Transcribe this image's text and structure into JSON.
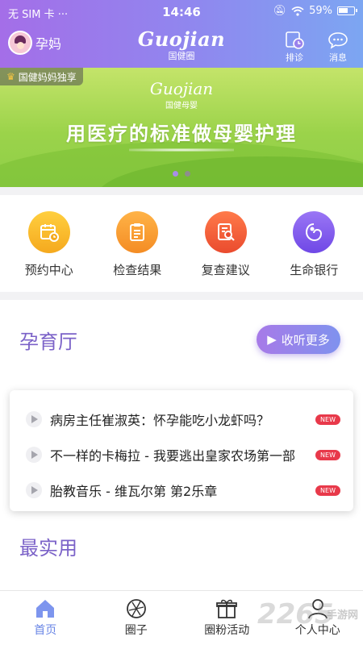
{
  "status": {
    "carrier": "无 SIM 卡 ···",
    "time": "14:46",
    "battery": "59%"
  },
  "header": {
    "mom_label": "孕妈",
    "logo_script": "Guojian",
    "logo_sub": "国健圈",
    "icons": [
      {
        "label": "排诊",
        "icon": "clock-calendar-icon"
      },
      {
        "label": "消息",
        "icon": "chat-bubble-icon"
      }
    ]
  },
  "banner": {
    "tag": "国健妈妈独享",
    "logo_script": "Guojian",
    "logo_sub": "国健母婴",
    "headline": "用医疗的标准做母婴护理",
    "slides": 2,
    "active_slide": 1
  },
  "quick": [
    {
      "label": "预约中心",
      "icon": "calendar-clock-icon",
      "color": "#f5b324"
    },
    {
      "label": "检查结果",
      "icon": "clipboard-icon",
      "color": "#f59a2b"
    },
    {
      "label": "复查建议",
      "icon": "search-report-icon",
      "color": "#f2603a"
    },
    {
      "label": "生命银行",
      "icon": "baby-icon",
      "color": "#8a5cf0"
    }
  ],
  "section1": {
    "title": "孕育厅",
    "listen_more": "收听更多"
  },
  "audio_list": [
    {
      "title": "病房主任崔淑英：怀孕能吃小龙虾吗？",
      "badge": "NEW"
    },
    {
      "title": "不一样的卡梅拉 - 我要逃出皇家农场第一部",
      "badge": "NEW"
    },
    {
      "title": "胎教音乐 - 维瓦尔第 第2乐章",
      "badge": "NEW"
    }
  ],
  "section2": {
    "title": "最实用"
  },
  "bottom_nav": [
    {
      "label": "首页",
      "icon": "home-icon",
      "active": true
    },
    {
      "label": "圈子",
      "icon": "aperture-icon",
      "active": false
    },
    {
      "label": "圈粉活动",
      "icon": "gift-icon",
      "active": false
    },
    {
      "label": "个人中心",
      "icon": "person-icon",
      "active": false
    }
  ],
  "watermark": {
    "text": "2265",
    "sub": "手游网"
  }
}
